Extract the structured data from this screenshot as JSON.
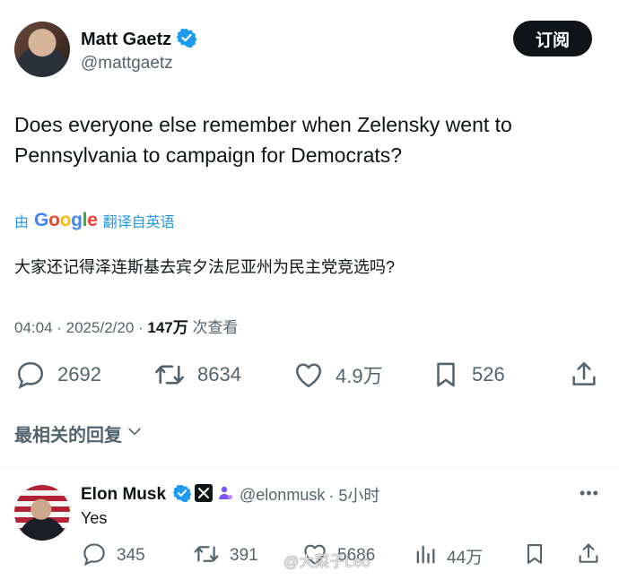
{
  "tweet": {
    "author_name": "Matt Gaetz",
    "author_handle": "@mattgaetz",
    "subscribe_label": "订阅",
    "text_line1": "Does everyone else remember when Zelensky went to",
    "text_line2": "Pennsylvania to campaign for Democrats?",
    "translate_prefix": "由",
    "translate_brand": "Google",
    "translate_suffix": "翻译自英语",
    "translated_text": "大家还记得泽连斯基去宾夕法尼亚州为民主党竞选吗?",
    "time": "04:04 · 2025/2/20 · ",
    "views": "147万",
    "views_suffix": " 次查看",
    "replies": "2692",
    "retweets": "8634",
    "likes": "4.9万",
    "bookmarks": "526"
  },
  "replies_header": {
    "label": "最相关的回复"
  },
  "reply": {
    "author_name": "Elon Musk",
    "author_handle": "@elonmusk",
    "time": " · 5小时",
    "more": "•••",
    "text": "Yes",
    "replies": "345",
    "retweets": "391",
    "likes": "5686",
    "views": "44万"
  },
  "watermark": {
    "text": "@大菜子Leo"
  },
  "colors": {
    "accent": "#1d9bf0",
    "muted": "#536471",
    "text": "#0f1419"
  },
  "icons": [
    "verified-badge-icon",
    "reply-icon",
    "retweet-icon",
    "like-icon",
    "bookmark-icon",
    "share-icon",
    "chevron-down-icon",
    "views-icon",
    "x-logo-icon",
    "affiliate-icon",
    "more-icon"
  ]
}
